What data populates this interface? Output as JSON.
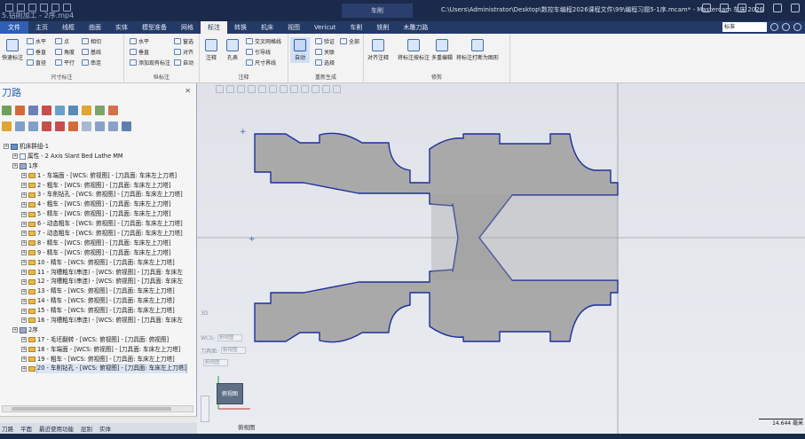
{
  "window": {
    "overlay_title": "5.钻削加工 - 2序.mp4",
    "tool_tab": "车削",
    "path": "C:\\Users\\Administrator\\Desktop\\数控车编程2026课程文件\\99\\编程习题5-1序.mcam* - Mastercam 车床 2026"
  },
  "ribbon_tabs": [
    {
      "label": "文件"
    },
    {
      "label": "主页"
    },
    {
      "label": "线框"
    },
    {
      "label": "曲面"
    },
    {
      "label": "实体"
    },
    {
      "label": "模型准备"
    },
    {
      "label": "网格"
    },
    {
      "label": "标注"
    },
    {
      "label": "转换"
    },
    {
      "label": "机床"
    },
    {
      "label": "视图"
    },
    {
      "label": "Vericut"
    },
    {
      "label": "车削"
    },
    {
      "label": "铣削"
    },
    {
      "label": "木雕刀路"
    }
  ],
  "top_right": {
    "select_value": "标准"
  },
  "ribbon": {
    "group1": {
      "label": "尺寸标注",
      "big": "快速标注",
      "items": [
        "水平",
        "点",
        "相切",
        "垂直",
        "角度",
        "基线",
        "直径",
        "平行",
        "串连"
      ]
    },
    "group2": {
      "label": "纵标注",
      "items": [
        "水平",
        "垂直",
        "添加现有标注",
        "窗选",
        "对齐",
        "自动"
      ]
    },
    "group3": {
      "label": "注释",
      "items": [
        "注释",
        "孔表",
        "交叉网格线",
        "引导线",
        "尺寸界线"
      ]
    },
    "group4": {
      "label": "重新生成",
      "items": [
        "自动",
        "验证",
        "全部",
        "关联",
        "选择"
      ]
    },
    "group5": {
      "label": "修剪",
      "items": [
        "对齐注释",
        "将标注按标注",
        "多重编辑",
        "将标注打断为图形"
      ]
    }
  },
  "panel": {
    "title": "刀路",
    "tree": [
      {
        "indent": 0,
        "kind": "mach",
        "label": "机床群组-1"
      },
      {
        "indent": 1,
        "kind": "prop",
        "label": "属性 - 2 Axis Slant Bed Lathe MM"
      },
      {
        "indent": 1,
        "kind": "grp",
        "label": "1序"
      },
      {
        "indent": 2,
        "kind": "fold",
        "label": "1 - 车端面 - [WCS: 俯视图] - [刀具面: 车床左上刀塔]"
      },
      {
        "indent": 2,
        "kind": "fold",
        "label": "2 - 粗车 - [WCS: 俯视图] - [刀具面: 车床左上刀塔]"
      },
      {
        "indent": 2,
        "kind": "fold",
        "label": "3 - 车削钻孔 - [WCS: 俯视图] - [刀具面: 车床左上刀塔]"
      },
      {
        "indent": 2,
        "kind": "fold",
        "label": "4 - 粗车 - [WCS: 俯视图] - [刀具面: 车床左上刀塔]"
      },
      {
        "indent": 2,
        "kind": "fold",
        "label": "5 - 精车 - [WCS: 俯视图] - [刀具面: 车床左上刀塔]"
      },
      {
        "indent": 2,
        "kind": "fold",
        "label": "6 - 动态粗车 - [WCS: 俯视图] - [刀具面: 车床左上刀塔]"
      },
      {
        "indent": 2,
        "kind": "fold",
        "label": "7 - 动态粗车 - [WCS: 俯视图] - [刀具面: 车床左上刀塔]"
      },
      {
        "indent": 2,
        "kind": "fold",
        "label": "8 - 精车 - [WCS: 俯视图] - [刀具面: 车床左上刀塔]"
      },
      {
        "indent": 2,
        "kind": "fold",
        "label": "9 - 精车 - [WCS: 俯视图] - [刀具面: 车床左上刀塔]"
      },
      {
        "indent": 2,
        "kind": "fold",
        "label": "10 - 精车 - [WCS: 俯视图] - [刀具面: 车床左上刀塔]"
      },
      {
        "indent": 2,
        "kind": "fold",
        "label": "11 - 沟槽粗车(串连) - [WCS: 俯视图] - [刀具面: 车床左"
      },
      {
        "indent": 2,
        "kind": "fold",
        "label": "12 - 沟槽粗车(串连) - [WCS: 俯视图] - [刀具面: 车床左"
      },
      {
        "indent": 2,
        "kind": "fold",
        "label": "13 - 精车 - [WCS: 俯视图] - [刀具面: 车床左上刀塔]"
      },
      {
        "indent": 2,
        "kind": "fold",
        "label": "14 - 精车 - [WCS: 俯视图] - [刀具面: 车床左上刀塔]"
      },
      {
        "indent": 2,
        "kind": "fold",
        "label": "15 - 精车 - [WCS: 俯视图] - [刀具面: 车床左上刀塔]"
      },
      {
        "indent": 2,
        "kind": "fold",
        "label": "16 - 沟槽粗车(串连) - [WCS: 俯视图] - [刀具面: 车床左"
      },
      {
        "indent": 1,
        "kind": "grp",
        "label": "2序"
      },
      {
        "indent": 2,
        "kind": "fold",
        "label": "17 - 毛坯翻转 - [WCS: 俯视图] - [刀具面: 俯视图]"
      },
      {
        "indent": 2,
        "kind": "fold",
        "label": "18 - 车端面 - [WCS: 俯视图] - [刀具面: 车床左上刀塔]"
      },
      {
        "indent": 2,
        "kind": "fold",
        "label": "19 - 粗车 - [WCS: 俯视图] - [刀具面: 车床左上刀塔]"
      },
      {
        "indent": 2,
        "kind": "fold",
        "label": "20 - 车削钻孔 - [WCS: 俯视图] - [刀具面: 车床左上刀塔]",
        "selected": true
      }
    ]
  },
  "bottom_tabs": [
    "刀路",
    "平面",
    "最近使用功能",
    "层别",
    "实体"
  ],
  "viewport": {
    "readouts": [
      {
        "label": "3D",
        "value": ""
      },
      {
        "label": "WCS:",
        "value": "俯视图"
      },
      {
        "label": "刀具面:",
        "value": "俯视图"
      },
      {
        "label": "",
        "value": "俯视图"
      }
    ],
    "viewcube": "俯视图",
    "view_label": "俯视图",
    "scale": "14.644 毫米"
  },
  "colors": {
    "part_outline": "#1f2f9c",
    "part_fill": "#a9a9a9",
    "axis": "#6a6a6a"
  }
}
